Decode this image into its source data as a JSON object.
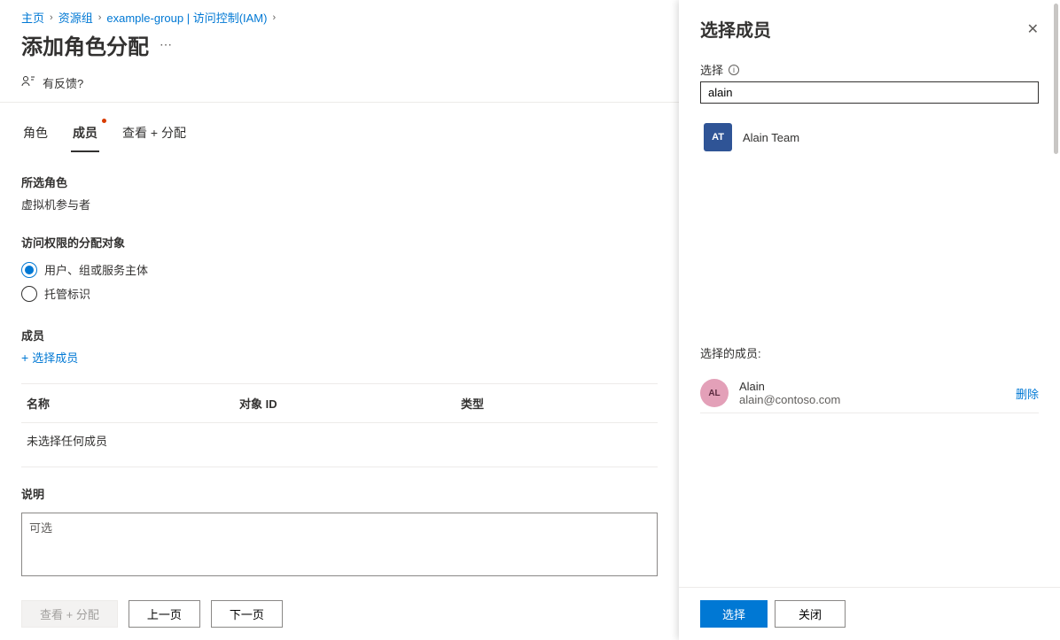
{
  "breadcrumb": {
    "home": "主页",
    "resource_groups": "资源组",
    "group_iam": "example-group | 访问控制(IAM)"
  },
  "page": {
    "title": "添加角色分配",
    "feedback": "有反馈?"
  },
  "tabs": {
    "role": "角色",
    "members": "成员",
    "review": "查看 + 分配"
  },
  "selected_role": {
    "label": "所选角色",
    "value": "虚拟机参与者"
  },
  "assign_access": {
    "label": "访问权限的分配对象",
    "option_user": "用户、组或服务主体",
    "option_managed": "托管标识"
  },
  "members": {
    "label": "成员",
    "select_link": "选择成员"
  },
  "table": {
    "col_name": "名称",
    "col_id": "对象 ID",
    "col_type": "类型",
    "empty": "未选择任何成员"
  },
  "description": {
    "label": "说明",
    "placeholder": "可选"
  },
  "footer": {
    "review": "查看 + 分配",
    "prev": "上一页",
    "next": "下一页"
  },
  "panel": {
    "title": "选择成员",
    "select_label": "选择",
    "search_value": "alain",
    "result": {
      "initials": "AT",
      "name": "Alain Team"
    },
    "selected_label": "选择的成员:",
    "selected_member": {
      "initials": "AL",
      "name": "Alain",
      "email": "alain@contoso.com"
    },
    "remove": "删除",
    "select_btn": "选择",
    "close_btn": "关闭"
  }
}
